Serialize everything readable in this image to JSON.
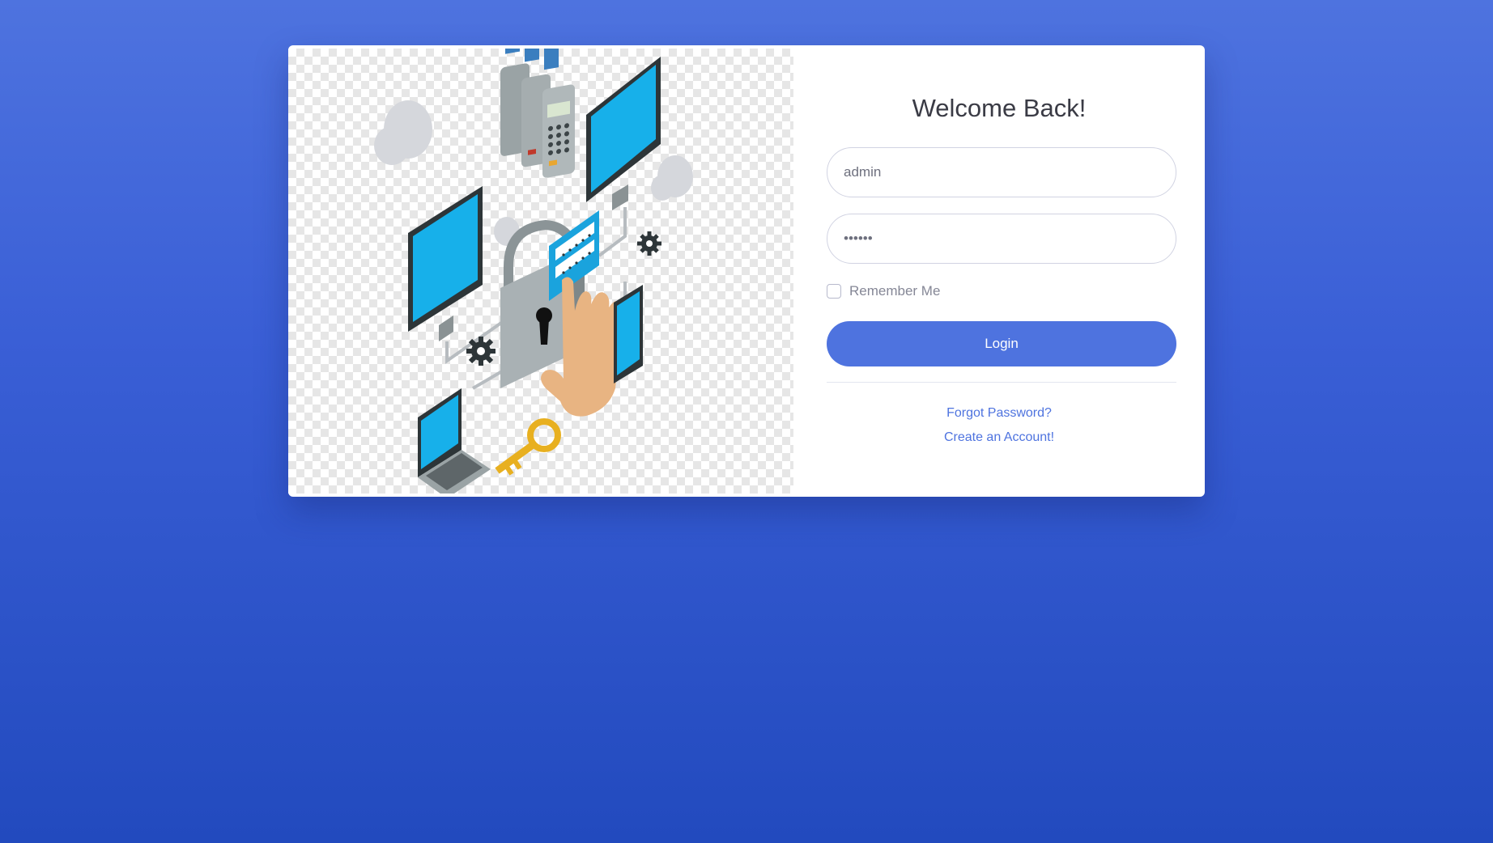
{
  "login": {
    "title": "Welcome Back!",
    "username_value": "admin",
    "password_value": "••••••",
    "remember_label": "Remember Me",
    "remember_checked": false,
    "login_label": "Login",
    "forgot_label": "Forgot Password?",
    "create_label": "Create an Account!"
  },
  "colors": {
    "accent": "#4e73df",
    "background_top": "#4e73df",
    "background_bottom": "#224abe"
  },
  "illustration": {
    "icons": [
      "cloud-icon",
      "payment-terminal-icon",
      "monitor-icon",
      "padlock-icon",
      "hand-icon",
      "password-card-icon",
      "gear-icon",
      "tablet-icon",
      "laptop-icon",
      "key-icon"
    ]
  }
}
